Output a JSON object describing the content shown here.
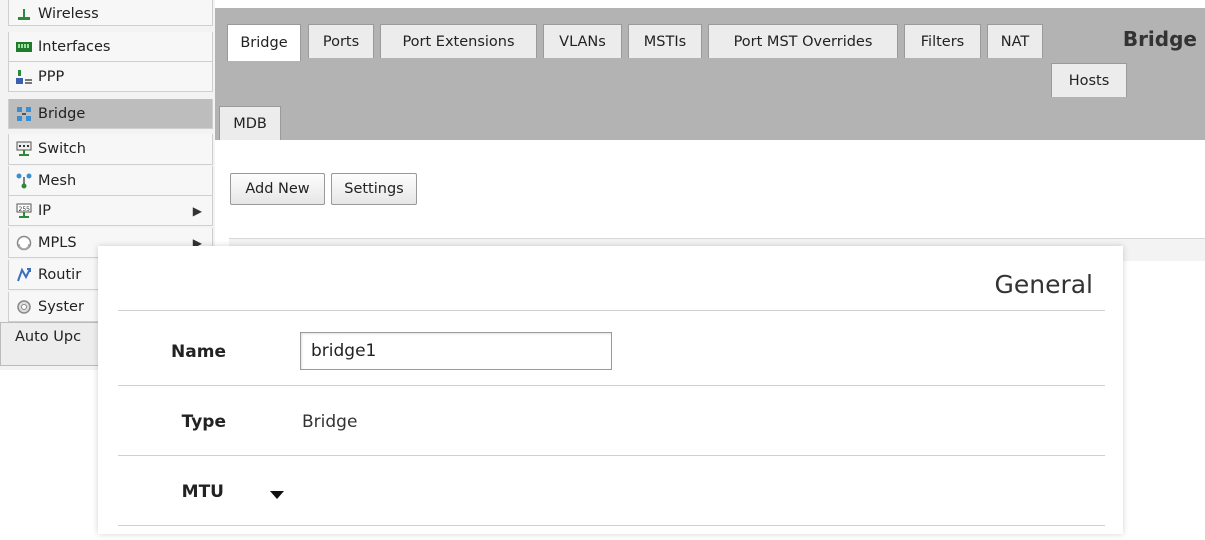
{
  "menu": {
    "items": [
      {
        "label": "Wireless",
        "icon": "wireless-icon"
      },
      {
        "label": "Interfaces",
        "icon": "interfaces-icon"
      },
      {
        "label": "PPP",
        "icon": "ppp-icon"
      },
      {
        "label": "Bridge",
        "icon": "bridge-icon"
      },
      {
        "label": "Switch",
        "icon": "switch-icon"
      },
      {
        "label": "Mesh",
        "icon": "mesh-icon"
      },
      {
        "label": "IP",
        "icon": "ip-icon"
      },
      {
        "label": "MPLS",
        "icon": "mpls-icon"
      },
      {
        "label": "Routir",
        "icon": "routing-icon"
      },
      {
        "label": "Syster",
        "icon": "system-icon"
      },
      {
        "label": "Auto Upc",
        "icon": ""
      }
    ],
    "submenu_arrow": "▶"
  },
  "tabs": {
    "row1": [
      "Bridge",
      "Ports",
      "Port Extensions",
      "VLANs",
      "MSTIs",
      "Port MST Overrides",
      "Filters",
      "NAT"
    ],
    "hosts": "Hosts",
    "mdb": "MDB",
    "bar_title": "Bridge"
  },
  "toolbar": {
    "add_new": "Add New",
    "settings": "Settings"
  },
  "dialog": {
    "title": "General",
    "name_label": "Name",
    "name_value": "bridge1",
    "type_label": "Type",
    "type_value": "Bridge",
    "mtu_label": "MTU"
  },
  "colors": {
    "tabbar_bg": "#b3b3b3",
    "menu_active_bg": "#bdbdbd"
  }
}
